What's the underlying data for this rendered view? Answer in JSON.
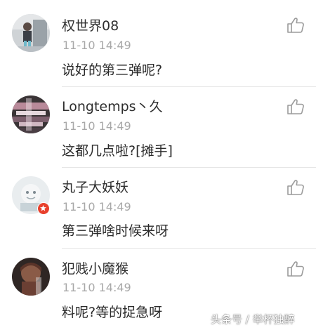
{
  "comments": [
    {
      "username": "权世界08",
      "time": "11-10 14:49",
      "text": "说好的第三弹呢?"
    },
    {
      "username": "Longtemps丶久",
      "time": "11-10 14:49",
      "text": "这都几点啦?[摊手]"
    },
    {
      "username": "丸子大妖妖",
      "time": "11-10 14:49",
      "text": "第三弹啥时候来呀"
    },
    {
      "username": "犯贱小魔猴",
      "time": "11-10 14:49",
      "text": "料呢?等的捉急呀"
    }
  ],
  "icons": {
    "like": "thumbs-up-icon",
    "badge": "red-badge-icon"
  },
  "colors": {
    "username": "#2e2e2e",
    "timestamp": "#a8a8a8",
    "comment_text": "#2a2a2a",
    "like_icon": "#9b9b9b",
    "divider": "#e6e6e6",
    "badge": "#e8402c"
  },
  "watermark": "头条号 / 举杯独醉"
}
